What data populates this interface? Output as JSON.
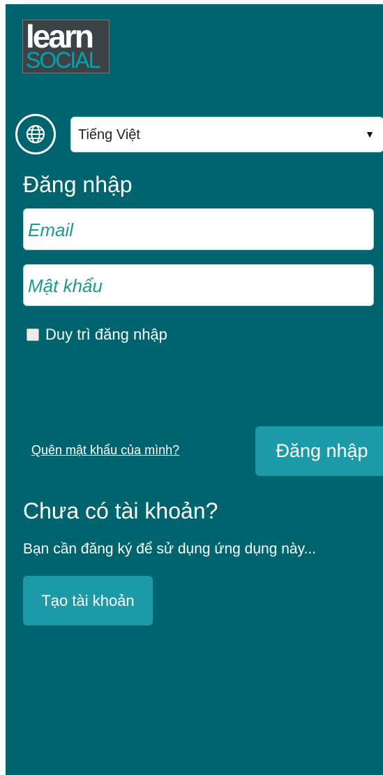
{
  "logo": {
    "line1": "learn",
    "line2": "SOCIAL"
  },
  "language": {
    "icon": "globe-icon",
    "selected": "Tiếng Việt",
    "arrow": "▼"
  },
  "login": {
    "heading": "Đăng nhập",
    "email_placeholder": "Email",
    "password_placeholder": "Mật khẩu",
    "remember_label": "Duy trì đăng nhập",
    "forgot_link": "Quên mật khẩu của mình?",
    "submit_label": "Đăng nhập"
  },
  "signup": {
    "heading": "Chưa có tài khoản?",
    "note": "Bạn cần đăng ký để sử dụng ứng dụng này...",
    "button_label": "Tạo tài khoản"
  },
  "colors": {
    "panel_bg": "#00646f",
    "button_bg": "#1c9aa8",
    "placeholder": "#1a9a93"
  }
}
